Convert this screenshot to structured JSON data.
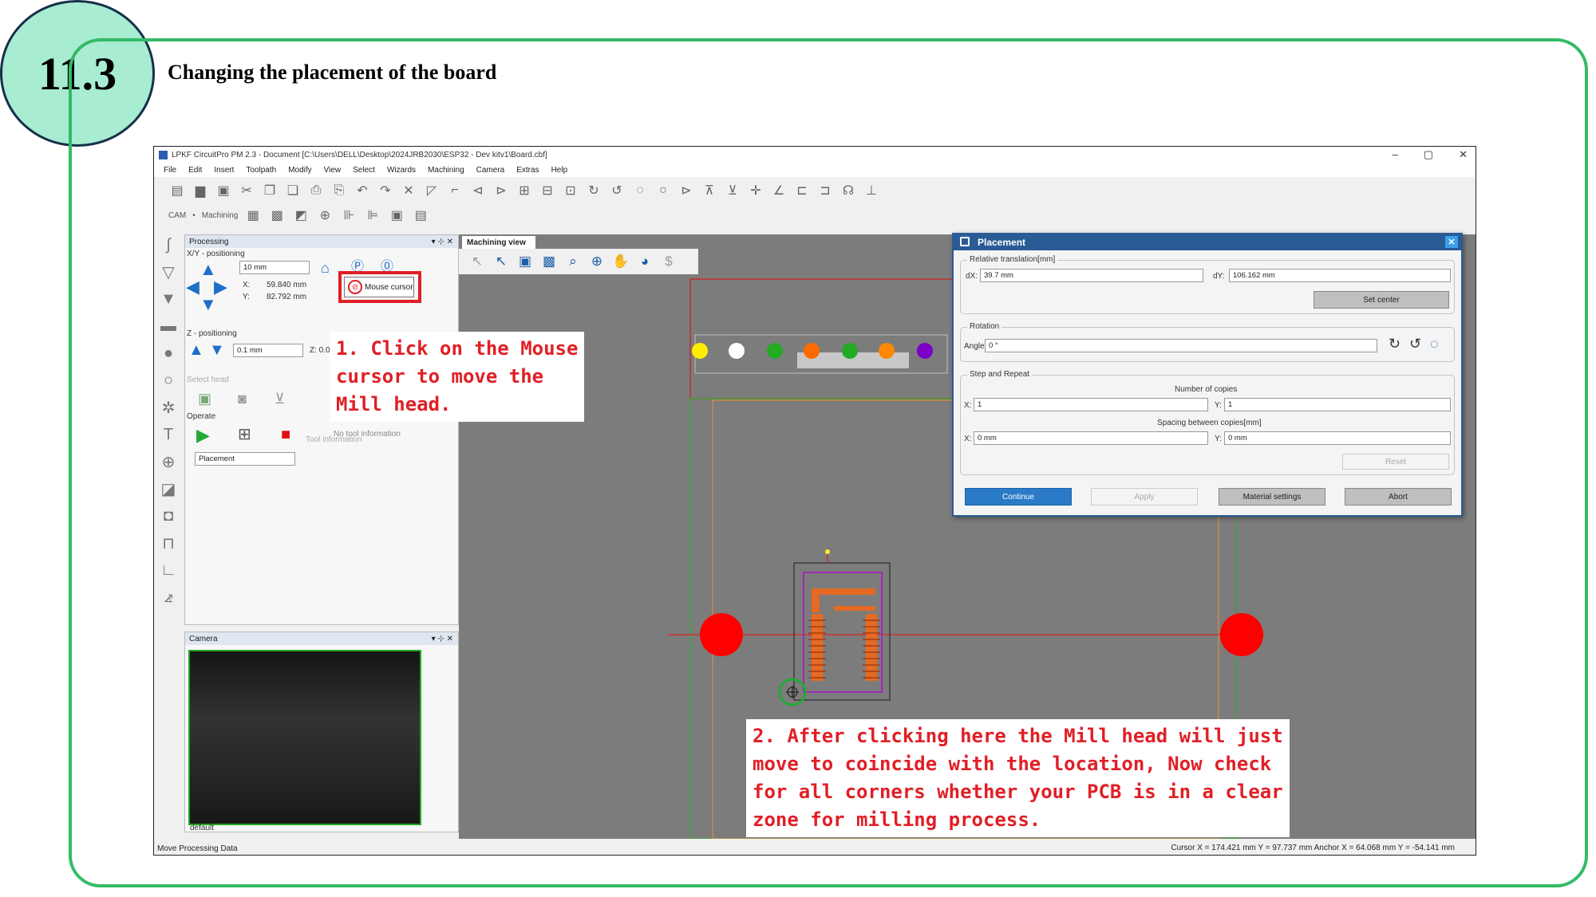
{
  "section": {
    "number": "11.3",
    "title": "Changing the placement of the board"
  },
  "window": {
    "title": "LPKF CircuitPro PM 2.3 - Document [C:\\Users\\DELL\\Desktop\\2024JRB2030\\ESP32 - Dev kitv1\\Board.cbf]",
    "controls": [
      "–",
      "▢",
      "✕"
    ]
  },
  "menu": [
    "File",
    "Edit",
    "Insert",
    "Toolpath",
    "Modify",
    "View",
    "Select",
    "Wizards",
    "Machining",
    "Camera",
    "Extras",
    "Help"
  ],
  "toolbar2": {
    "cam": "CAM",
    "machining": "Machining"
  },
  "processing": {
    "panel_title": "Processing",
    "xy_label": "X/Y - positioning",
    "step_value": "10 mm",
    "x_label": "X:",
    "x_value": "59.840 mm",
    "y_label": "Y:",
    "y_value": "82.792 mm",
    "mouse_cursor_label": "Mouse cursor",
    "z_label": "Z - positioning",
    "z_step": "0.1 mm",
    "z_value": "Z: 0.0",
    "select_head": "Select head",
    "tool_info_label": "Tool information",
    "no_tool_info": "No tool information",
    "operate_label": "Operate",
    "operate_select": "Placement"
  },
  "camera": {
    "panel_title": "Camera",
    "source": "default"
  },
  "callouts": {
    "c1": "1. Click on the Mouse\ncursor to move the\nMill head.",
    "c2": "2. After clicking here the Mill head will just\nmove to coincide with the location, Now check\nfor all corners whether your PCB is in a clear\nzone for milling process."
  },
  "machining_view": {
    "tab_label": "Machining view"
  },
  "placement_dialog": {
    "title": "Placement",
    "relative_translation": "Relative translation[mm]",
    "dx_label": "dX:",
    "dx_value": "39.7 mm",
    "dy_label": "dY:",
    "dy_value": "106.162 mm",
    "set_center": "Set center",
    "rotation": "Rotation",
    "angle_label": "Angle",
    "angle_value": "0 °",
    "step_repeat": "Step and Repeat",
    "num_copies": "Number of copies",
    "copies_x_label": "X:",
    "copies_x": "1",
    "copies_y_label": "Y:",
    "copies_y": "1",
    "spacing": "Spacing between copies[mm]",
    "spacing_x_label": "X:",
    "spacing_x": "0 mm",
    "spacing_y_label": "Y:",
    "spacing_y": "0 mm",
    "reset": "Reset",
    "continue": "Continue",
    "apply": "Apply",
    "material_settings": "Material settings",
    "abort": "Abort"
  },
  "status": {
    "left": "Move Processing Data",
    "right": "Cursor X =   174.421 mm   Y =   97.737 mm        Anchor X =   64.068 mm   Y =   -54.141 mm"
  },
  "colors": {
    "accent_green": "#33bb66",
    "badge_fill": "#a8ecd2",
    "highlight_red": "#e01f26",
    "dialog_blue": "#2a5b96"
  }
}
